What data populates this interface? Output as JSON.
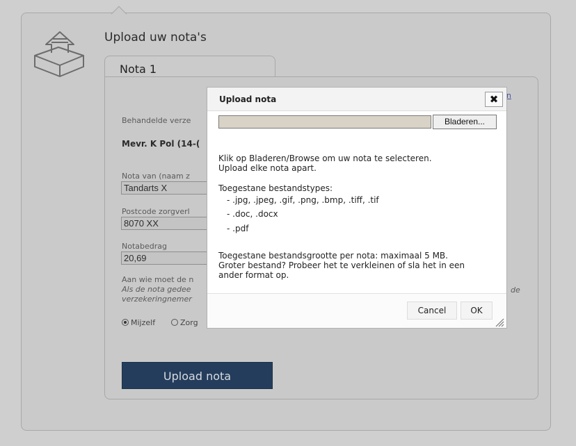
{
  "page": {
    "title": "Upload uw nota's",
    "tab_label": "Nota 1"
  },
  "form": {
    "insured_label": "Behandelde verze",
    "insured_value": "Mevr. K Pol (14-(",
    "nota_from_label": "Nota van (naam z",
    "nota_from_value": "Tandarts X",
    "postcode_label": "Postcode zorgverl",
    "postcode_value": "8070 XX",
    "amount_label": "Notabedrag",
    "amount_value": "20,69",
    "payee_label": "Aan wie moet de n",
    "payee_note_1": "Als de nota gedee",
    "payee_note_2": "verzekeringnemer",
    "payee_note_right": "de",
    "radio_self": "Mijzelf",
    "radio_other": "Zorg",
    "upload_button": "Upload nota"
  },
  "dialog": {
    "title": "Upload nota",
    "close_symbol": "✖",
    "browse_button": "Bladeren...",
    "instruction_1": "Klik op Bladeren/Browse om uw nota te selecteren.",
    "instruction_2": "Upload elke nota apart.",
    "types_heading": "Toegestane bestandstypes:",
    "types": [
      "- .jpg, .jpeg, .gif, .png, .bmp, .tiff, .tif",
      "- .doc, .docx",
      "- .pdf"
    ],
    "size_line_1": "Toegestane bestandsgrootte per nota: maximaal 5 MB.",
    "size_line_2": "Groter bestand? Probeer het te verkleinen of sla het in een",
    "size_line_3": "ander format op.",
    "cancel_button": "Cancel",
    "ok_button": "OK"
  },
  "colors": {
    "upload_button_bg": "#243d5c",
    "overlay_gray": "#cfcfcf"
  },
  "icons": {
    "upload_logo": "upload-box-icon",
    "close": "close-icon",
    "resize": "resize-grip-icon"
  }
}
